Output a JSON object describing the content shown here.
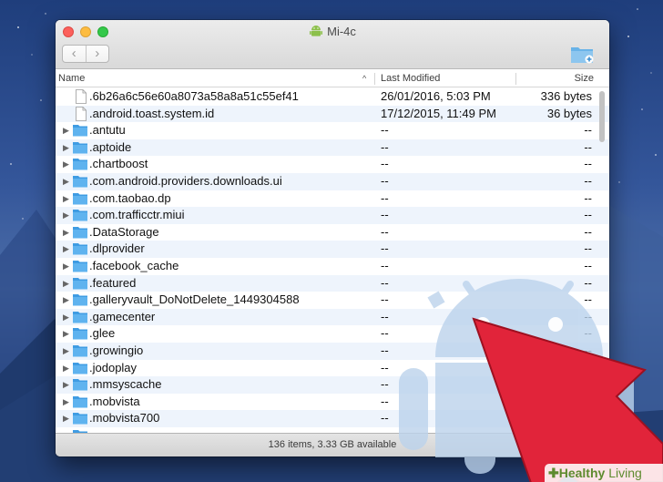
{
  "window": {
    "title": "Mi-4c",
    "nav": {
      "back": "‹",
      "forward": "›"
    }
  },
  "columns": {
    "name": "Name",
    "last_modified": "Last Modified",
    "size": "Size",
    "sort_indicator": "^"
  },
  "files": [
    {
      "name": ".6b26a6c56e60a8073a58a8a51c55ef41",
      "modified": "26/01/2016, 5:03 PM",
      "size": "336 bytes",
      "kind": "file"
    },
    {
      "name": ".android.toast.system.id",
      "modified": "17/12/2015, 11:49 PM",
      "size": "36 bytes",
      "kind": "file"
    },
    {
      "name": ".antutu",
      "modified": "--",
      "size": "--",
      "kind": "folder"
    },
    {
      "name": ".aptoide",
      "modified": "--",
      "size": "--",
      "kind": "folder"
    },
    {
      "name": ".chartboost",
      "modified": "--",
      "size": "--",
      "kind": "folder"
    },
    {
      "name": ".com.android.providers.downloads.ui",
      "modified": "--",
      "size": "--",
      "kind": "folder"
    },
    {
      "name": ".com.taobao.dp",
      "modified": "--",
      "size": "--",
      "kind": "folder"
    },
    {
      "name": ".com.trafficctr.miui",
      "modified": "--",
      "size": "--",
      "kind": "folder"
    },
    {
      "name": ".DataStorage",
      "modified": "--",
      "size": "--",
      "kind": "folder"
    },
    {
      "name": ".dlprovider",
      "modified": "--",
      "size": "--",
      "kind": "folder"
    },
    {
      "name": ".facebook_cache",
      "modified": "--",
      "size": "--",
      "kind": "folder"
    },
    {
      "name": ".featured",
      "modified": "--",
      "size": "--",
      "kind": "folder"
    },
    {
      "name": ".galleryvault_DoNotDelete_1449304588",
      "modified": "--",
      "size": "--",
      "kind": "folder"
    },
    {
      "name": ".gamecenter",
      "modified": "--",
      "size": "--",
      "kind": "folder"
    },
    {
      "name": ".glee",
      "modified": "--",
      "size": "--",
      "kind": "folder"
    },
    {
      "name": ".growingio",
      "modified": "--",
      "size": "--",
      "kind": "folder"
    },
    {
      "name": ".jodoplay",
      "modified": "--",
      "size": "--",
      "kind": "folder"
    },
    {
      "name": ".mmsyscache",
      "modified": "--",
      "size": "--",
      "kind": "folder"
    },
    {
      "name": ".mobvista",
      "modified": "--",
      "size": "--",
      "kind": "folder"
    },
    {
      "name": ".mobvista700",
      "modified": "--",
      "size": "--",
      "kind": "folder"
    },
    {
      "name": "",
      "modified": "",
      "size": "",
      "kind": "folder"
    }
  ],
  "status": "136 items, 3.33 GB available",
  "watermark": {
    "plus": "✚",
    "part1": "Healthy",
    "part2": "Living"
  },
  "colors": {
    "folder": "#5fb3ef",
    "arrow": "#e1243a",
    "selection_alt": "#eef4fc",
    "android": "#bcd3ec"
  },
  "icons": {
    "expand": "disclosure-triangle-icon",
    "folder": "folder-icon",
    "file": "document-icon",
    "new_folder": "new-folder-icon",
    "app": "android-icon"
  }
}
